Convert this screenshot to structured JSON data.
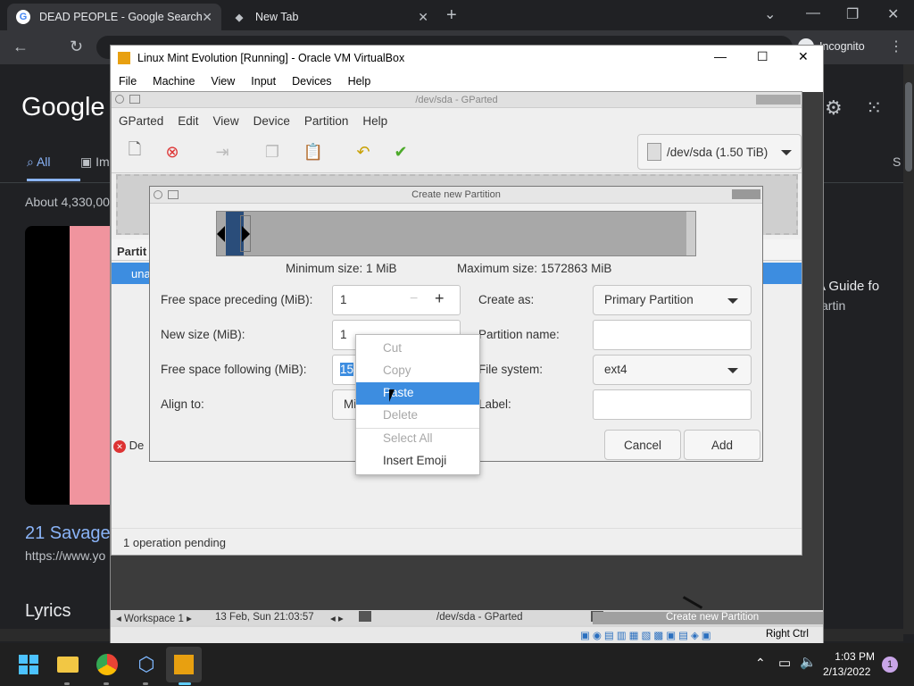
{
  "browser": {
    "tabs": [
      {
        "title": "DEAD PEOPLE - Google Search",
        "active": true
      },
      {
        "title": "New Tab",
        "active": false
      }
    ],
    "profile_label": "Incognito"
  },
  "google": {
    "logo": "Google",
    "tabs": [
      "All",
      "Im",
      "S"
    ],
    "results_count": "About 4,330,00",
    "result_title": "21 Savage",
    "result_url": "https://www.yo",
    "right_result_title": "k: A Guide fo",
    "right_result_sub": "artin",
    "lyrics_heading": "Lyrics"
  },
  "vbox": {
    "title": "Linux Mint Evolution [Running] - Oracle VM VirtualBox",
    "menu": [
      "File",
      "Machine",
      "View",
      "Input",
      "Devices",
      "Help"
    ],
    "host_key": "Right Ctrl"
  },
  "gparted": {
    "title": "/dev/sda - GParted",
    "menu": [
      "GParted",
      "Edit",
      "View",
      "Device",
      "Partition",
      "Help"
    ],
    "device": "/dev/sda (1.50 TiB)",
    "partition_header": "Partit",
    "partition_row": "una",
    "pending_prefix": "De",
    "status": "1 operation pending"
  },
  "dialog": {
    "title": "Create new Partition",
    "min_size": "Minimum size: 1 MiB",
    "max_size": "Maximum size: 1572863 MiB",
    "free_preceding_label": "Free space preceding (MiB):",
    "free_preceding_value": "1",
    "new_size_label": "New size (MiB):",
    "new_size_value": "1",
    "free_following_label": "Free space following (MiB):",
    "free_following_value": "15",
    "align_label": "Align to:",
    "align_value": "Mi",
    "create_as_label": "Create as:",
    "create_as_value": "Primary Partition",
    "partition_name_label": "Partition name:",
    "partition_name_value": "",
    "file_system_label": "File system:",
    "file_system_value": "ext4",
    "label_label": "Label:",
    "label_value": "",
    "cancel": "Cancel",
    "add": "Add"
  },
  "context_menu": {
    "items": [
      {
        "label": "Cut",
        "enabled": false
      },
      {
        "label": "Copy",
        "enabled": false
      },
      {
        "label": "Paste",
        "enabled": true,
        "highlighted": true
      },
      {
        "label": "Delete",
        "enabled": false
      },
      {
        "label": "Select All",
        "enabled": false
      },
      {
        "label": "Insert Emoji",
        "enabled": true
      }
    ]
  },
  "guest_panel": {
    "workspace": "Workspace 1",
    "datetime": "13 Feb, Sun 21:03:57",
    "task1": "/dev/sda - GParted",
    "task2": "Create new Partition"
  },
  "taskbar": {
    "time": "1:03 PM",
    "date": "2/13/2022",
    "notification_count": "1"
  }
}
